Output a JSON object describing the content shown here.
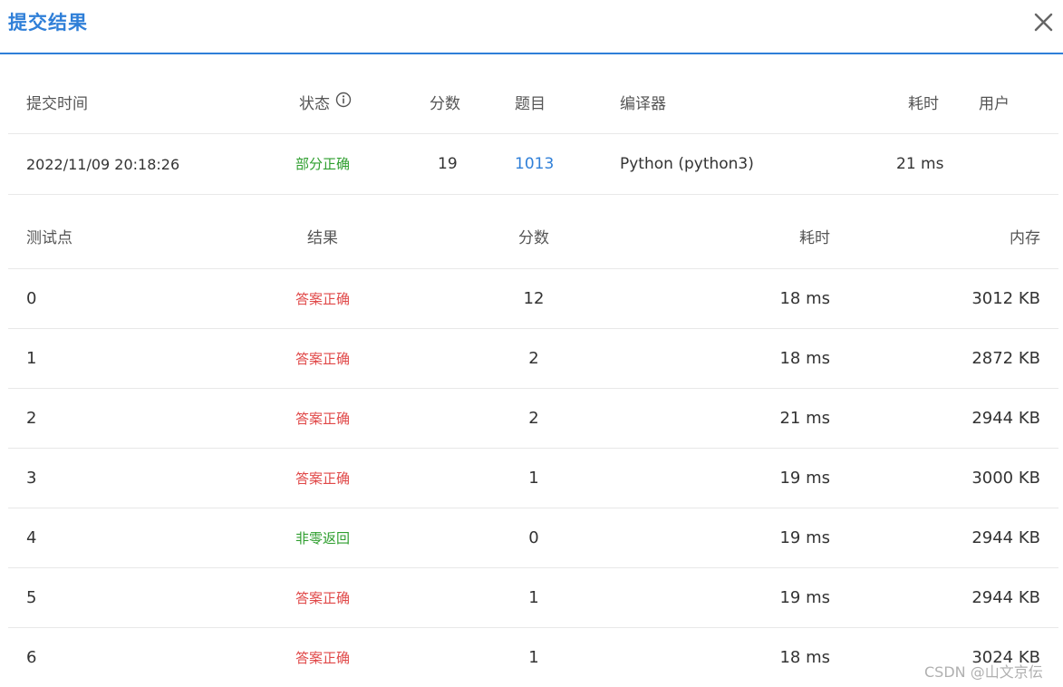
{
  "dialog": {
    "title": "提交结果"
  },
  "summary": {
    "headers": {
      "time": "提交时间",
      "status": "状态",
      "score": "分数",
      "problem": "题目",
      "compiler": "编译器",
      "elapsed": "耗时",
      "user": "用户"
    },
    "row": {
      "time": "2022/11/09 20:18:26",
      "status": "部分正确",
      "score": "19",
      "problem": "1013",
      "compiler": "Python (python3)",
      "elapsed": "21 ms",
      "user": ""
    }
  },
  "tests": {
    "headers": {
      "point": "测试点",
      "result": "结果",
      "score": "分数",
      "elapsed": "耗时",
      "memory": "内存"
    },
    "rows": [
      {
        "point": "0",
        "result": "答案正确",
        "score": "12",
        "elapsed": "18 ms",
        "memory": "3012 KB"
      },
      {
        "point": "1",
        "result": "答案正确",
        "score": "2",
        "elapsed": "18 ms",
        "memory": "2872 KB"
      },
      {
        "point": "2",
        "result": "答案正确",
        "score": "2",
        "elapsed": "21 ms",
        "memory": "2944 KB"
      },
      {
        "point": "3",
        "result": "答案正确",
        "score": "1",
        "elapsed": "19 ms",
        "memory": "3000 KB"
      },
      {
        "point": "4",
        "result": "非零返回",
        "score": "0",
        "elapsed": "19 ms",
        "memory": "2944 KB"
      },
      {
        "point": "5",
        "result": "答案正确",
        "score": "1",
        "elapsed": "19 ms",
        "memory": "2944 KB"
      },
      {
        "point": "6",
        "result": "答案正确",
        "score": "1",
        "elapsed": "18 ms",
        "memory": "3024 KB"
      }
    ]
  },
  "watermark": "CSDN @山文京伝",
  "icons": {
    "close": "close-icon",
    "info": "info-icon"
  },
  "colors": {
    "accent": "#2f7fd8",
    "correct": "#e04848",
    "partial": "#2e9e2e",
    "nonzero": "#2e9e2e"
  }
}
